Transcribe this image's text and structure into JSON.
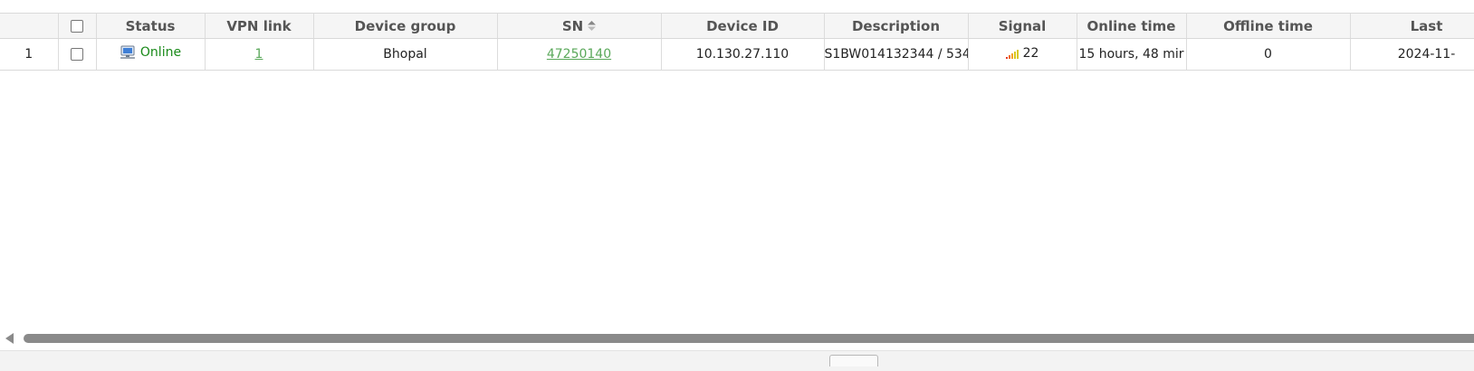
{
  "table": {
    "columns": {
      "rownum": "",
      "select": "",
      "status": "Status",
      "vpn_link": "VPN link",
      "device_group": "Device group",
      "sn": "SN",
      "device_id": "Device ID",
      "description": "Description",
      "signal": "Signal",
      "online_time": "Online time",
      "offline_time": "Offline time",
      "last": "Last"
    },
    "rows": [
      {
        "rownum": "1",
        "status": "Online",
        "status_icon": "computer-monitor-icon",
        "vpn_link": "1",
        "device_group": "Bhopal",
        "sn": "47250140",
        "device_id": "10.130.27.110",
        "description": "S1BW014132344 / 534",
        "signal": "22",
        "signal_icon": "signal-bars-icon",
        "online_time": "15 hours, 48 mir",
        "offline_time": "0",
        "last": "2024-11-"
      }
    ],
    "sort_icon": "sort-icon"
  },
  "colors": {
    "status_online": "#1a8a1a",
    "link": "#5aa85a",
    "header_bg": "#f5f5f5",
    "scrollbar": "#8a8a8a"
  }
}
